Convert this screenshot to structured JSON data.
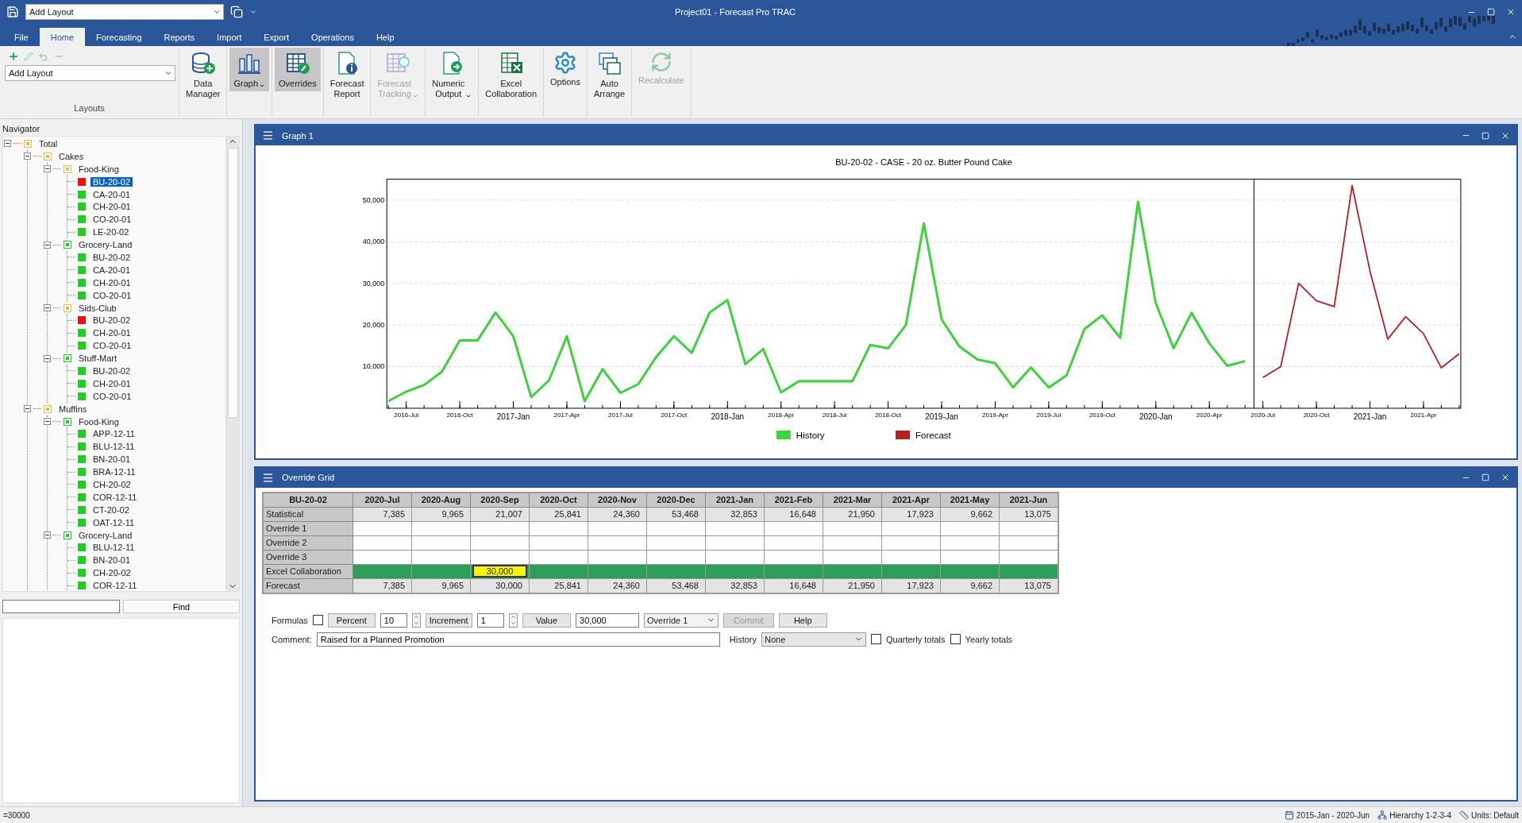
{
  "window": {
    "title": "Project01 - Forecast Pro TRAC",
    "quick_layout": "Add Layout"
  },
  "tabs": [
    {
      "label": "File",
      "selected": false
    },
    {
      "label": "Home",
      "selected": true
    },
    {
      "label": "Forecasting",
      "selected": false
    },
    {
      "label": "Reports",
      "selected": false
    },
    {
      "label": "Import",
      "selected": false
    },
    {
      "label": "Export",
      "selected": false
    },
    {
      "label": "Operations",
      "selected": false
    },
    {
      "label": "Help",
      "selected": false
    }
  ],
  "ribbon": {
    "layouts": {
      "combo": "Add Layout",
      "label": "Layouts"
    },
    "buttons": [
      {
        "label": "Data Manager",
        "pressed": false,
        "disabled": false,
        "dropdown": false
      },
      {
        "label": "Graph",
        "pressed": true,
        "disabled": false,
        "dropdown": true
      },
      {
        "label": "Overrides",
        "pressed": true,
        "disabled": false,
        "dropdown": false
      },
      {
        "label": "Forecast Report",
        "pressed": false,
        "disabled": false,
        "dropdown": false
      },
      {
        "label": "Forecast Tracking",
        "pressed": false,
        "disabled": true,
        "dropdown": true
      },
      {
        "label": "Numeric Output",
        "pressed": false,
        "disabled": false,
        "dropdown": true
      },
      {
        "label": "Excel Collaboration",
        "pressed": false,
        "disabled": false,
        "dropdown": false
      },
      {
        "label": "Options",
        "pressed": false,
        "disabled": false,
        "dropdown": false
      },
      {
        "label": "Auto Arrange",
        "pressed": false,
        "disabled": false,
        "dropdown": false
      },
      {
        "label": "Recalculate",
        "pressed": false,
        "disabled": true,
        "dropdown": false
      }
    ]
  },
  "navigator": {
    "title": "Navigator",
    "find_button": "Find",
    "tree": [
      {
        "label": "Total",
        "color": "#f5b746",
        "expanded": true,
        "selected": false,
        "children": [
          {
            "label": "Cakes",
            "color": "#f5b746",
            "expanded": true,
            "selected": false,
            "children": [
              {
                "label": "Food-King",
                "color": "#f5b746",
                "expanded": true,
                "selected": false,
                "children": [
                  {
                    "label": "BU-20-02",
                    "color": "#ee1111",
                    "selected": true
                  },
                  {
                    "label": "CA-20-01",
                    "color": "#22cc22",
                    "selected": false
                  },
                  {
                    "label": "CH-20-01",
                    "color": "#22cc22",
                    "selected": false
                  },
                  {
                    "label": "CO-20-01",
                    "color": "#22cc22",
                    "selected": false
                  },
                  {
                    "label": "LE-20-02",
                    "color": "#22cc22",
                    "selected": false
                  }
                ]
              },
              {
                "label": "Grocery-Land",
                "color": "#22cc22",
                "expanded": true,
                "selected": false,
                "children": [
                  {
                    "label": "BU-20-02",
                    "color": "#22cc22",
                    "selected": false
                  },
                  {
                    "label": "CA-20-01",
                    "color": "#22cc22",
                    "selected": false
                  },
                  {
                    "label": "CH-20-01",
                    "color": "#22cc22",
                    "selected": false
                  },
                  {
                    "label": "CO-20-01",
                    "color": "#22cc22",
                    "selected": false
                  }
                ]
              },
              {
                "label": "Sids-Club",
                "color": "#f5b746",
                "expanded": true,
                "selected": false,
                "children": [
                  {
                    "label": "BU-20-02",
                    "color": "#ee1111",
                    "selected": false
                  },
                  {
                    "label": "CH-20-01",
                    "color": "#22cc22",
                    "selected": false
                  },
                  {
                    "label": "CO-20-01",
                    "color": "#22cc22",
                    "selected": false
                  }
                ]
              },
              {
                "label": "Stuff-Mart",
                "color": "#22cc22",
                "expanded": true,
                "selected": false,
                "children": [
                  {
                    "label": "BU-20-02",
                    "color": "#22cc22",
                    "selected": false
                  },
                  {
                    "label": "CH-20-01",
                    "color": "#22cc22",
                    "selected": false
                  },
                  {
                    "label": "CO-20-01",
                    "color": "#22cc22",
                    "selected": false
                  }
                ]
              }
            ]
          },
          {
            "label": "Muffins",
            "color": "#f5b746",
            "expanded": true,
            "selected": false,
            "children": [
              {
                "label": "Food-King",
                "color": "#22cc22",
                "expanded": true,
                "selected": false,
                "children": [
                  {
                    "label": "APP-12-11",
                    "color": "#22cc22",
                    "selected": false
                  },
                  {
                    "label": "BLU-12-11",
                    "color": "#22cc22",
                    "selected": false
                  },
                  {
                    "label": "BN-20-01",
                    "color": "#22cc22",
                    "selected": false
                  },
                  {
                    "label": "BRA-12-11",
                    "color": "#22cc22",
                    "selected": false
                  },
                  {
                    "label": "CH-20-02",
                    "color": "#22cc22",
                    "selected": false
                  },
                  {
                    "label": "COR-12-11",
                    "color": "#22cc22",
                    "selected": false
                  },
                  {
                    "label": "CT-20-02",
                    "color": "#22cc22",
                    "selected": false
                  },
                  {
                    "label": "OAT-12-11",
                    "color": "#22cc22",
                    "selected": false
                  }
                ]
              },
              {
                "label": "Grocery-Land",
                "color": "#22cc22",
                "expanded": true,
                "selected": false,
                "children": [
                  {
                    "label": "BLU-12-11",
                    "color": "#22cc22",
                    "selected": false
                  },
                  {
                    "label": "BN-20-01",
                    "color": "#22cc22",
                    "selected": false
                  },
                  {
                    "label": "CH-20-02",
                    "color": "#22cc22",
                    "selected": false
                  },
                  {
                    "label": "COR-12-11",
                    "color": "#22cc22",
                    "selected": false
                  }
                ]
              }
            ]
          }
        ]
      }
    ]
  },
  "graph_window": {
    "title": "Graph 1",
    "chart_data": {
      "type": "line",
      "title": "BU-20-02 - CASE - 20 oz. Butter Pound Cake",
      "categories": [
        null,
        "2016-Jul",
        null,
        null,
        "2016-Oct",
        null,
        null,
        "2017-Jan",
        null,
        null,
        "2017-Apr",
        null,
        null,
        "2017-Jul",
        null,
        null,
        "2017-Oct",
        null,
        null,
        "2018-Jan",
        null,
        null,
        "2018-Apr",
        null,
        null,
        "2018-Jul",
        null,
        null,
        "2018-Oct",
        null,
        null,
        "2019-Jan",
        null,
        null,
        "2019-Apr",
        null,
        null,
        "2019-Jul",
        null,
        null,
        "2019-Oct",
        null,
        null,
        "2020-Jan",
        null,
        null,
        "2020-Apr",
        null,
        null,
        "2020-Jul",
        null,
        null,
        "2020-Oct",
        null,
        null,
        "2021-Jan",
        null,
        null,
        "2021-Apr",
        null,
        null
      ],
      "series": [
        {
          "name": "History",
          "color": "#3ed33e",
          "values": [
            1700,
            4000,
            5600,
            8800,
            16300,
            16300,
            23000,
            17300,
            2700,
            6700,
            17300,
            1700,
            9400,
            3700,
            5800,
            12300,
            17300,
            13300,
            23000,
            26000,
            10600,
            14200,
            3800,
            6500,
            6500,
            6500,
            6500,
            15200,
            14400,
            20000,
            44400,
            21300,
            14800,
            11700,
            10800,
            5000,
            9800,
            5000,
            7900,
            19000,
            22300,
            16900,
            49600,
            25200,
            14400,
            22900,
            15600,
            10200,
            11300,
            null,
            null,
            null,
            null,
            null,
            null,
            null,
            null,
            null,
            null,
            null,
            null
          ]
        },
        {
          "name": "Forecast",
          "color": "#b22222",
          "values": [
            null,
            null,
            null,
            null,
            null,
            null,
            null,
            null,
            null,
            null,
            null,
            null,
            null,
            null,
            null,
            null,
            null,
            null,
            null,
            null,
            null,
            null,
            null,
            null,
            null,
            null,
            null,
            null,
            null,
            null,
            null,
            null,
            null,
            null,
            null,
            null,
            null,
            null,
            null,
            null,
            null,
            null,
            null,
            null,
            null,
            null,
            null,
            null,
            null,
            7400,
            10000,
            30000,
            25800,
            24400,
            53500,
            32900,
            16600,
            22000,
            17900,
            9700,
            13100
          ]
        }
      ],
      "ylim": [
        0,
        55000
      ],
      "grid": true,
      "legend": "bottom",
      "yticks": [
        {
          "value": 10000,
          "label": "10,000"
        },
        {
          "value": 20000,
          "label": "20,000"
        },
        {
          "value": 30000,
          "label": "30,000"
        },
        {
          "value": 40000,
          "label": "40,000"
        },
        {
          "value": 50000,
          "label": "50,000"
        }
      ]
    }
  },
  "override_window": {
    "title": "Override Grid",
    "table": {
      "corner": "BU-20-02",
      "columns": [
        "2020-Jul",
        "2020-Aug",
        "2020-Sep",
        "2020-Oct",
        "2020-Nov",
        "2020-Dec",
        "2021-Jan",
        "2021-Feb",
        "2021-Mar",
        "2021-Apr",
        "2021-May",
        "2021-Jun"
      ],
      "rows": [
        {
          "label": "Statistical",
          "kind": "value",
          "cells": [
            {
              "value": "7,385"
            },
            {
              "value": "9,965"
            },
            {
              "value": "21,007"
            },
            {
              "value": "25,841"
            },
            {
              "value": "24,360"
            },
            {
              "value": "53,468"
            },
            {
              "value": "32,853"
            },
            {
              "value": "16,648"
            },
            {
              "value": "21,950"
            },
            {
              "value": "17,923"
            },
            {
              "value": "9,662"
            },
            {
              "value": "13,075"
            }
          ]
        },
        {
          "label": "Override 1",
          "kind": "override"
        },
        {
          "label": "Override 2",
          "kind": "override"
        },
        {
          "label": "Override 3",
          "kind": "override"
        },
        {
          "label": "Excel Collaboration",
          "kind": "collaboration",
          "cells": [
            {
              "selected": false
            },
            {
              "selected": false
            },
            {
              "value": "30,000",
              "selected": true
            },
            {
              "selected": false
            },
            {
              "selected": false
            },
            {
              "selected": false
            },
            {
              "selected": false
            },
            {
              "selected": false
            },
            {
              "selected": false
            },
            {
              "selected": false
            },
            {
              "selected": false
            },
            {
              "selected": false
            }
          ]
        },
        {
          "label": "Forecast",
          "kind": "value",
          "cells": [
            {
              "value": "7,385"
            },
            {
              "value": "9,965"
            },
            {
              "value": "30,000"
            },
            {
              "value": "25,841"
            },
            {
              "value": "24,360"
            },
            {
              "value": "53,468"
            },
            {
              "value": "32,853"
            },
            {
              "value": "16,648"
            },
            {
              "value": "21,950"
            },
            {
              "value": "17,923"
            },
            {
              "value": "9,662"
            },
            {
              "value": "13,075"
            }
          ]
        }
      ]
    },
    "controls": {
      "formulas_label": "Formulas",
      "formulas_checked": false,
      "percent_button": "Percent",
      "percent_value": "10",
      "increment_button": "Increment",
      "increment_value": "1",
      "value_button": "Value",
      "value_field": "30,000",
      "target": "Override 1",
      "commit_button": "Commit",
      "commit_disabled": true,
      "help_button": "Help",
      "comment_label": "Comment:",
      "comment": "Raised for a Planned Promotion",
      "history_label": "History",
      "history": "None",
      "quarterly_label": "Quarterly totals",
      "quarterly_checked": false,
      "yearly_label": "Yearly totals",
      "yearly_checked": false
    }
  },
  "status_bar": {
    "formula": "=30000",
    "range": "2015-Jan - 2020-Jun",
    "hierarchy": "Hierarchy 1-2-3-4",
    "units": "Units: Default"
  }
}
